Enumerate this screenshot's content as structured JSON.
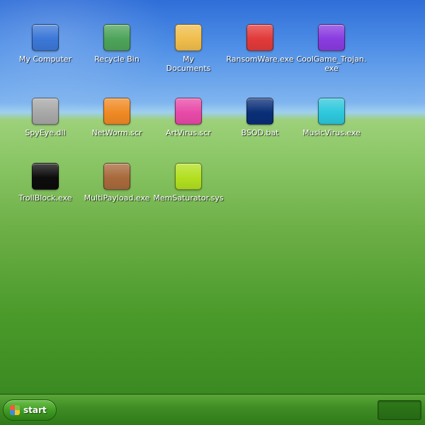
{
  "desktop": {
    "icons": [
      {
        "label": "My Computer",
        "color": "#3c78d8"
      },
      {
        "label": "Recycle Bin",
        "color": "#4ea45a"
      },
      {
        "label": "My Documents",
        "color": "#f0be4c"
      },
      {
        "label": "RansomWare.exe",
        "color": "#e23a3a"
      },
      {
        "label": "CoolGame_Trojan.exe",
        "color": "#8a3ce0"
      },
      {
        "label": "SpyEye.dll",
        "color": "#a8a8a8"
      },
      {
        "label": "NetWorm.scr",
        "color": "#f08a24"
      },
      {
        "label": "ArtVirus.scr",
        "color": "#e84aa8"
      },
      {
        "label": "BSOD.bat",
        "color": "#0a2f78"
      },
      {
        "label": "MusicVirus.exe",
        "color": "#2ec8dc"
      },
      {
        "label": "TrollBlock.exe",
        "color": "#0c0c0c"
      },
      {
        "label": "MultiPayload.exe",
        "color": "#a86a3c"
      },
      {
        "label": "MemSaturator.sys",
        "color": "#b2e020"
      }
    ]
  },
  "taskbar": {
    "start_label": "start",
    "start_logo_colors": [
      "#f05a3c",
      "#7cc242",
      "#3c8ae0",
      "#f5c52a"
    ]
  }
}
